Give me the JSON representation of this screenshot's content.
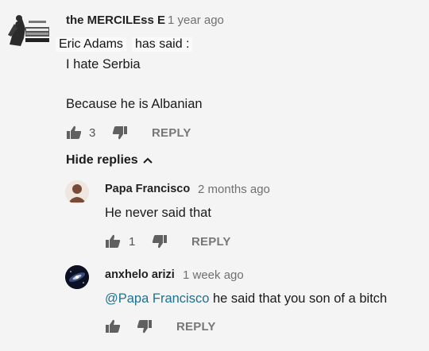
{
  "comment": {
    "author": "the MERCILEss E",
    "time": "1 year ago",
    "overlay_text": "Eric Adams",
    "overlay_said": "has said :",
    "line1": "I hate Serbia",
    "line2": "Because he is Albanian",
    "likes": "3",
    "reply_label": "REPLY",
    "avatar_icon": "soldier-avatar-icon"
  },
  "hide_replies": {
    "label": "Hide replies",
    "icon": "chevron-up-icon"
  },
  "replies": [
    {
      "author": "Papa Francisco",
      "time": "2 months ago",
      "text": "He never said that",
      "likes": "1",
      "reply_label": "REPLY",
      "avatar_icon": "default-user-avatar-icon"
    },
    {
      "author": "anxhelo arizi",
      "time": "1 week ago",
      "mention": "@Papa Francisco",
      "text": " he said that you son of a bitch",
      "reply_label": "REPLY",
      "avatar_icon": "galaxy-avatar-icon"
    }
  ],
  "colors": {
    "background": "#f4f4f4",
    "mention": "#21708f",
    "muted": "#707070",
    "icon": "#606060"
  }
}
